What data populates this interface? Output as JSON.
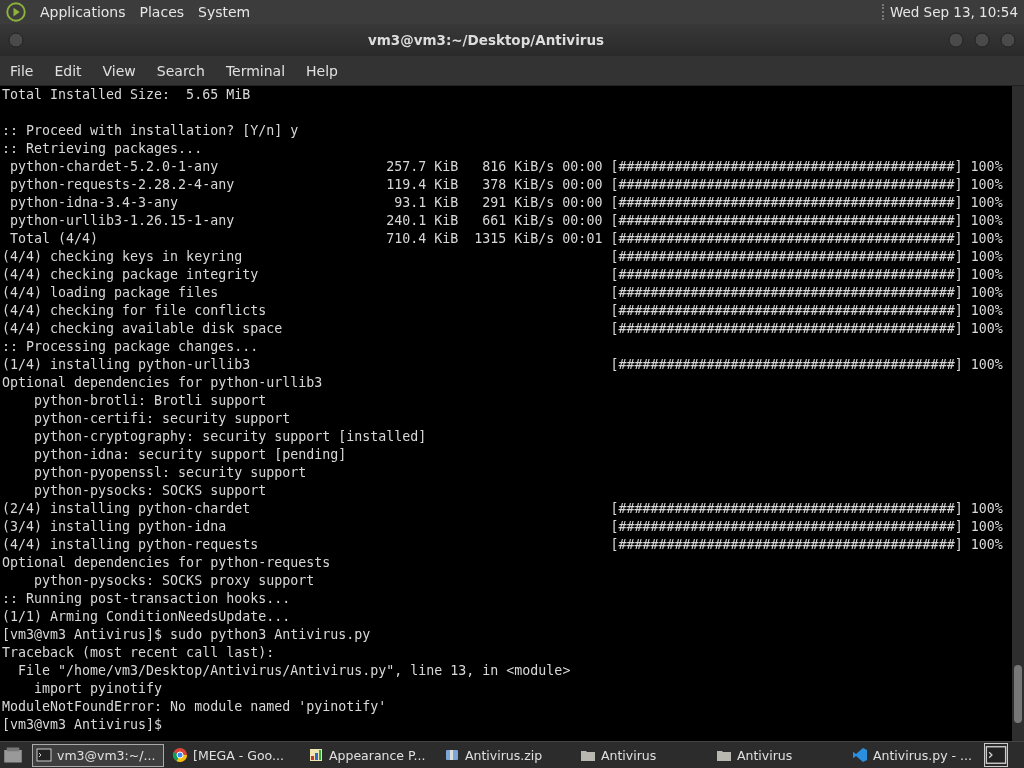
{
  "top_panel": {
    "menus": [
      "Applications",
      "Places",
      "System"
    ],
    "clock": "Wed Sep 13, 10:54"
  },
  "window": {
    "title": "vm3@vm3:~/Desktop/Antivirus"
  },
  "menu_bar": [
    "File",
    "Edit",
    "View",
    "Search",
    "Terminal",
    "Help"
  ],
  "terminal": {
    "lines": [
      {
        "kind": "text",
        "text": "Total Installed Size:  5.65 MiB"
      },
      {
        "kind": "blank"
      },
      {
        "kind": "text",
        "text": ":: Proceed with installation? [Y/n] y"
      },
      {
        "kind": "text",
        "text": ":: Retrieving packages..."
      },
      {
        "kind": "download",
        "name": "python-chardet-5.2.0-1-any",
        "size": "257.7 KiB",
        "rate": "816 KiB/s",
        "time": "00:00",
        "bar": "[##########################################]",
        "percent": "100%"
      },
      {
        "kind": "download",
        "name": "python-requests-2.28.2-4-any",
        "size": "119.4 KiB",
        "rate": "378 KiB/s",
        "time": "00:00",
        "bar": "[##########################################]",
        "percent": "100%"
      },
      {
        "kind": "download",
        "name": "python-idna-3.4-3-any",
        "size": "93.1 KiB",
        "rate": "291 KiB/s",
        "time": "00:00",
        "bar": "[##########################################]",
        "percent": "100%"
      },
      {
        "kind": "download",
        "name": "python-urllib3-1.26.15-1-any",
        "size": "240.1 KiB",
        "rate": "661 KiB/s",
        "time": "00:00",
        "bar": "[##########################################]",
        "percent": "100%"
      },
      {
        "kind": "download",
        "name": "Total (4/4)",
        "size": "710.4 KiB",
        "rate": "1315 KiB/s",
        "time": "00:01",
        "bar": "[##########################################]",
        "percent": "100%"
      },
      {
        "kind": "progress",
        "text": "(4/4) checking keys in keyring",
        "bar": "[##########################################]",
        "percent": "100%"
      },
      {
        "kind": "progress",
        "text": "(4/4) checking package integrity",
        "bar": "[##########################################]",
        "percent": "100%"
      },
      {
        "kind": "progress",
        "text": "(4/4) loading package files",
        "bar": "[##########################################]",
        "percent": "100%"
      },
      {
        "kind": "progress",
        "text": "(4/4) checking for file conflicts",
        "bar": "[##########################################]",
        "percent": "100%"
      },
      {
        "kind": "progress",
        "text": "(4/4) checking available disk space",
        "bar": "[##########################################]",
        "percent": "100%"
      },
      {
        "kind": "text",
        "text": ":: Processing package changes..."
      },
      {
        "kind": "progress",
        "text": "(1/4) installing python-urllib3",
        "bar": "[##########################################]",
        "percent": "100%"
      },
      {
        "kind": "text",
        "text": "Optional dependencies for python-urllib3"
      },
      {
        "kind": "text",
        "text": "    python-brotli: Brotli support"
      },
      {
        "kind": "text",
        "text": "    python-certifi: security support"
      },
      {
        "kind": "text",
        "text": "    python-cryptography: security support [installed]"
      },
      {
        "kind": "text",
        "text": "    python-idna: security support [pending]"
      },
      {
        "kind": "text",
        "text": "    python-pyopenssl: security support"
      },
      {
        "kind": "text",
        "text": "    python-pysocks: SOCKS support"
      },
      {
        "kind": "progress",
        "text": "(2/4) installing python-chardet",
        "bar": "[##########################################]",
        "percent": "100%"
      },
      {
        "kind": "progress",
        "text": "(3/4) installing python-idna",
        "bar": "[##########################################]",
        "percent": "100%"
      },
      {
        "kind": "progress",
        "text": "(4/4) installing python-requests",
        "bar": "[##########################################]",
        "percent": "100%"
      },
      {
        "kind": "text",
        "text": "Optional dependencies for python-requests"
      },
      {
        "kind": "text",
        "text": "    python-pysocks: SOCKS proxy support"
      },
      {
        "kind": "text",
        "text": ":: Running post-transaction hooks..."
      },
      {
        "kind": "text",
        "text": "(1/1) Arming ConditionNeedsUpdate..."
      },
      {
        "kind": "text",
        "text": "[vm3@vm3 Antivirus]$ sudo python3 Antivirus.py"
      },
      {
        "kind": "text",
        "text": "Traceback (most recent call last):"
      },
      {
        "kind": "text",
        "text": "  File \"/home/vm3/Desktop/Antivirus/Antivirus.py\", line 13, in <module>"
      },
      {
        "kind": "text",
        "text": "    import pyinotify"
      },
      {
        "kind": "text",
        "text": "ModuleNotFoundError: No module named 'pyinotify'"
      },
      {
        "kind": "text",
        "text": "[vm3@vm3 Antivirus]$"
      }
    ]
  },
  "taskbar": [
    {
      "label": "vm3@vm3:~/...",
      "kind": "terminal",
      "selected": true
    },
    {
      "label": "[MEGA - Goo...",
      "kind": "browser",
      "selected": false
    },
    {
      "label": "Appearance P...",
      "kind": "appearance",
      "selected": false
    },
    {
      "label": "Antivirus.zip",
      "kind": "archive",
      "selected": false
    },
    {
      "label": "Antivirus",
      "kind": "folder",
      "selected": false
    },
    {
      "label": "Antivirus",
      "kind": "folder",
      "selected": false
    },
    {
      "label": "Antivirus.py - ...",
      "kind": "editor",
      "selected": false
    }
  ]
}
